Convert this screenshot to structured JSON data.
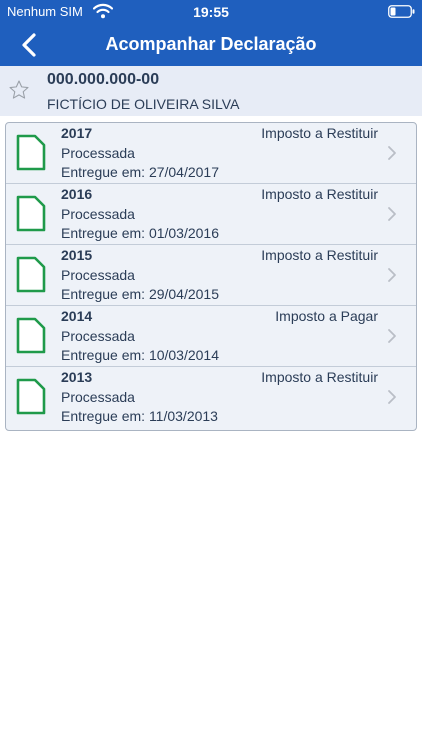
{
  "status_bar": {
    "carrier": "Nenhum SIM",
    "time": "19:55"
  },
  "navbar": {
    "title": "Acompanhar Declaração"
  },
  "taxpayer": {
    "cpf": "000.000.000-00",
    "name": "FICTÍCIO DE OLIVEIRA SILVA"
  },
  "declarations": [
    {
      "year": "2017",
      "kind": "Imposto a Restituir",
      "status": "Processada",
      "delivered": "Entregue em: 27/04/2017"
    },
    {
      "year": "2016",
      "kind": "Imposto a Restituir",
      "status": "Processada",
      "delivered": "Entregue em: 01/03/2016"
    },
    {
      "year": "2015",
      "kind": "Imposto a Restituir",
      "status": "Processada",
      "delivered": "Entregue em: 29/04/2015"
    },
    {
      "year": "2014",
      "kind": "Imposto a Pagar",
      "status": "Processada",
      "delivered": "Entregue em: 10/03/2014"
    },
    {
      "year": "2013",
      "kind": "Imposto a Restituir",
      "status": "Processada",
      "delivered": "Entregue em: 11/03/2013"
    }
  ],
  "colors": {
    "brand_blue": "#1f5fbe",
    "header_bg": "#e7ecf6",
    "list_bg": "#eef2f8",
    "doc_icon_green": "#1f9a4a",
    "text_dark": "#2b3d57"
  },
  "icons": {
    "back": "chevron-left-icon",
    "favorite": "star-outline-icon",
    "document": "file-icon",
    "disclosure": "chevron-right-icon"
  }
}
